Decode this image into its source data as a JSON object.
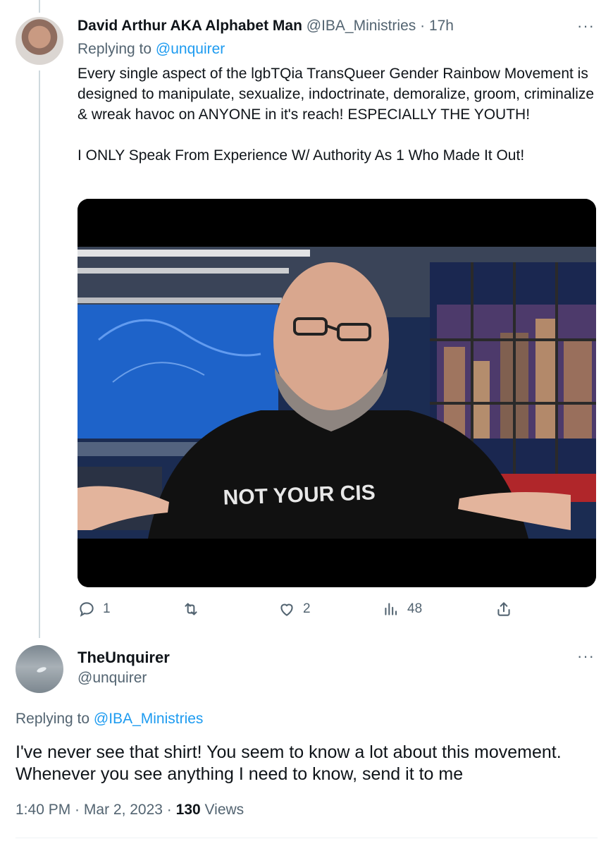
{
  "tweet1": {
    "author_name": "David Arthur AKA Alphabet Man",
    "handle": "@IBA_Ministries",
    "separator": " · ",
    "time": "17h",
    "replying_prefix": "Replying to ",
    "replying_to": "@unquirer",
    "text_lines": [
      "Every single aspect of the lgbTQia TransQueer Gender Rainbow Movement is designed to manipulate, sexualize, indoctrinate, demoralize, groom, criminalize & wreak havoc on ANYONE in it's reach! ESPECIALLY THE YOUTH!",
      "I ONLY Speak From Experience W/ Authority As 1 Who Made It Out!"
    ],
    "media_shirt_text": "NOT YOUR CIS",
    "actions": {
      "reply_count": "1",
      "retweet_count": "",
      "like_count": "2",
      "views_count": "48"
    },
    "more_icon": "···"
  },
  "tweet2": {
    "author_name": "TheUnquirer",
    "handle": "@unquirer",
    "replying_prefix": "Replying to ",
    "replying_to": "@IBA_Ministries",
    "text": "I've never see that shirt!  You seem to know a lot about this movement. Whenever you see anything I need to know, send it to me",
    "time": "1:40 PM",
    "date": "Mar 2, 2023",
    "separator": " · ",
    "views_count": "130",
    "views_label": " Views",
    "more_icon": "···"
  },
  "colors": {
    "text": "#0f1419",
    "secondary": "#536471",
    "link": "#1d9bf0",
    "thread_line": "#cfd9de"
  }
}
